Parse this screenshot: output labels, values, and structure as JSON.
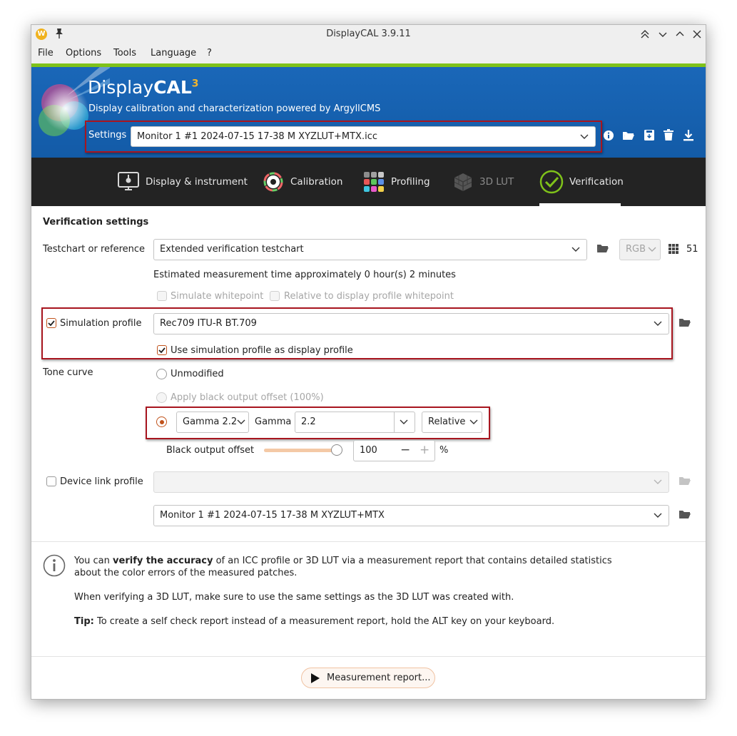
{
  "window": {
    "title": "DisplayCAL 3.9.11"
  },
  "menu": [
    "File",
    "Options",
    "Tools",
    "Language",
    "?"
  ],
  "banner": {
    "brand_light": "Display",
    "brand_bold": "CAL",
    "brand_sup": "3",
    "subtitle": "Display calibration and characterization powered by ArgyllCMS",
    "settings_label": "Settings",
    "settings_value": "Monitor 1 #1 2024-07-15 17-38 M XYZLUT+MTX.icc"
  },
  "tabs": [
    {
      "label": "Display & instrument",
      "icon": "display-instrument-icon"
    },
    {
      "label": "Calibration",
      "icon": "calibration-icon"
    },
    {
      "label": "Profiling",
      "icon": "profiling-icon"
    },
    {
      "label": "3D LUT",
      "icon": "3dlut-icon",
      "disabled": true
    },
    {
      "label": "Verification",
      "icon": "verification-icon",
      "active": true
    }
  ],
  "verification": {
    "heading": "Verification settings",
    "testchart_label": "Testchart or reference",
    "testchart_value": "Extended verification testchart",
    "colorspace": "RGB",
    "patch_count": "51",
    "estimate": "Estimated measurement time approximately 0 hour(s) 2 minutes",
    "simulate_whitepoint": "Simulate whitepoint",
    "relative_whitepoint": "Relative to display profile whitepoint",
    "simulation_profile_label": "Simulation profile",
    "simulation_profile_value": "Rec709 ITU-R BT.709",
    "use_as_display_profile": "Use simulation profile as display profile",
    "tone_curve_label": "Tone curve",
    "unmodified": "Unmodified",
    "apply_black_offset": "Apply black output offset (100%)",
    "gamma_preset": "Gamma 2.2",
    "gamma_label": "Gamma",
    "gamma_value": "2.2",
    "gamma_mode": "Relative",
    "black_offset_label": "Black output offset",
    "black_offset_value": "100",
    "black_offset_level": 1.0,
    "percent": "%",
    "device_link_label": "Device link profile",
    "device_link_value": "",
    "output_profile_value": "Monitor 1 #1 2024-07-15 17-38 M XYZLUT+MTX"
  },
  "info": {
    "p1_pre": "You can ",
    "p1_bold": "verify the accuracy",
    "p1_post": " of an ICC profile or 3D LUT via a measurement report that contains detailed statistics",
    "p1_line2": "about the color errors of the measured patches.",
    "p2": "When verifying a 3D LUT, make sure to use the same settings as the 3D LUT was created with.",
    "tip_label": "Tip:",
    "tip_text": " To create a self check report instead of a measurement report, hold the ALT key on your keyboard."
  },
  "action": {
    "measurement_report": "Measurement report..."
  },
  "colors": {
    "accent": "#c0521b",
    "banner": "#1a67b8",
    "green": "#7fc21a",
    "tabbar": "#232323",
    "highlight": "#a8151f"
  }
}
